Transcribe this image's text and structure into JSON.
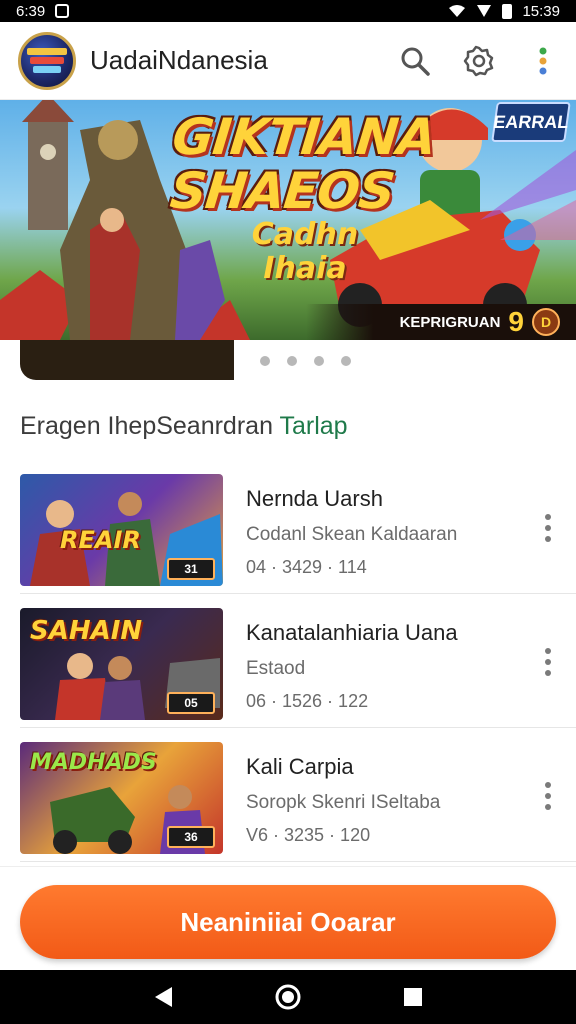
{
  "status_bar": {
    "time_left": "6:39",
    "time_right": "15:39"
  },
  "app_bar": {
    "title": "UadaiNdanesia",
    "logo_icon": "app-logo-icon",
    "search_icon": "search-icon",
    "settings_icon": "gear-icon",
    "menu_icon": "more-vert-icon"
  },
  "banner": {
    "title": "GIKTIANA SHAEOS",
    "subtitle": "Cadhn Ihaia",
    "badge": "EARRAL",
    "footer_text": "KEPRIGRUAN",
    "footer_num": "9",
    "footer_circle": "D",
    "dots_count": 4
  },
  "section": {
    "title_main": "Eragen IhepSeanrdran ",
    "title_accent": "Tarlap",
    "accent_color": "#1f7a4a"
  },
  "games": [
    {
      "name": "Nernda Uarsh",
      "genre": "Codanl Skean Kaldaaran",
      "meta": "04 · 3429 · 114",
      "thumb_title": "REAIR",
      "thumb_badge": "31",
      "thumb_bg": "#2d5aa8"
    },
    {
      "name": "Kanatalanhiaria Uana",
      "genre": "Estaod",
      "meta": "06 · 1526 · 122",
      "thumb_title": "SAHAIN",
      "thumb_badge": "05",
      "thumb_bg": "#2a2340"
    },
    {
      "name": "Kali Carpia",
      "genre": "Soropk Skenri ISeltaba",
      "meta": "V6 · 3235 · 120",
      "thumb_title": "MADHADS",
      "thumb_badge": "36",
      "thumb_bg": "#5a2a7a"
    }
  ],
  "cta": {
    "label": "Neaniniiai Ooarar",
    "color": "#f25a17"
  },
  "nav": {
    "back_icon": "back-icon",
    "home_icon": "home-icon",
    "recents_icon": "recents-icon"
  }
}
